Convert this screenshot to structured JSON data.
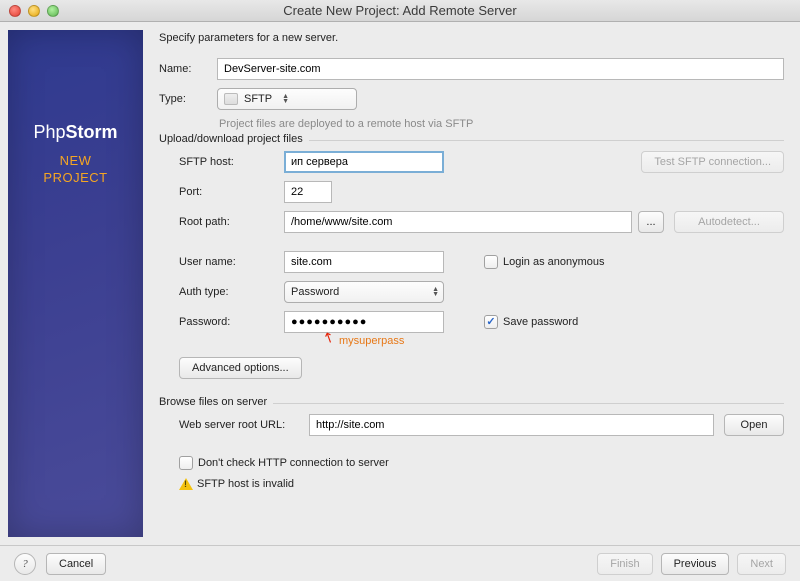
{
  "window_title": "Create New Project: Add Remote Server",
  "sidebar": {
    "logo_part1": "Php",
    "logo_part2": "Storm",
    "line1": "NEW",
    "line2": "PROJECT"
  },
  "intro": "Specify parameters for a new server.",
  "name_label": "Name:",
  "name_value": "DevServer-site.com",
  "type_label": "Type:",
  "type_value": "SFTP",
  "type_hint": "Project files are deployed to a remote host via SFTP",
  "section_upload": "Upload/download project files",
  "sftp_host_label": "SFTP host:",
  "sftp_host_value": "ип сервера",
  "test_conn_label": "Test SFTP connection...",
  "port_label": "Port:",
  "port_value": "22",
  "root_label": "Root path:",
  "root_value": "/home/www/site.com",
  "autodetect_label": "Autodetect...",
  "user_label": "User name:",
  "user_value": "site.com",
  "login_anon_label": "Login as anonymous",
  "auth_label": "Auth type:",
  "auth_value": "Password",
  "pass_label": "Password:",
  "pass_value": "●●●●●●●●●●",
  "save_pass_label": "Save password",
  "annotation": "mysuperpass",
  "adv_label": "Advanced options...",
  "section_browse": "Browse files on server",
  "web_root_label": "Web server root URL:",
  "web_root_value": "http://site.com",
  "open_label": "Open",
  "dont_check_label": "Don't check HTTP connection to server",
  "warn_text": "SFTP host is invalid",
  "help": "?",
  "cancel": "Cancel",
  "finish": "Finish",
  "previous": "Previous",
  "next": "Next"
}
